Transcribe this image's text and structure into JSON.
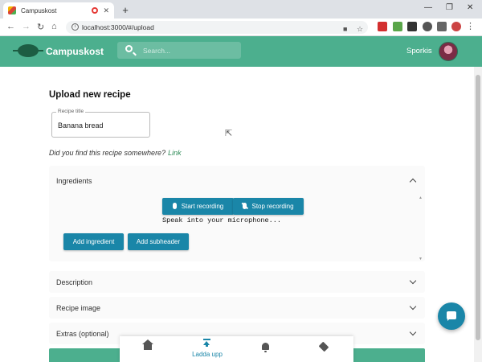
{
  "browser": {
    "tab_title": "Campuskost",
    "url": "localhost:3000/#/upload"
  },
  "header": {
    "brand": "Campuskost",
    "search_placeholder": "Search...",
    "username": "Sporkis"
  },
  "form": {
    "title": "Upload new recipe",
    "recipe_title_label": "Recipe title",
    "recipe_title_value": "Banana bread",
    "found_text": "Did you find this recipe somewhere?",
    "found_link": "Link"
  },
  "ingredients": {
    "heading": "Ingredients",
    "start_recording": "Start recording",
    "stop_recording": "Stop recording",
    "speak_prompt": "Speak into your microphone...",
    "add_ingredient": "Add ingredient",
    "add_subheader": "Add subheader"
  },
  "sections": {
    "description": "Description",
    "recipe_image": "Recipe image",
    "extras": "Extras (optional)"
  },
  "bottom_nav": {
    "upload_label": "Ladda upp"
  },
  "icons": [
    "home-icon",
    "upload-icon",
    "bell-icon",
    "tag-icon",
    "chat-icon",
    "search-icon",
    "mic-icon",
    "mic-off-icon",
    "chevron-up-icon",
    "chevron-down-icon"
  ],
  "colors": {
    "brand_green": "#4caf8e",
    "button_blue": "#1a86a8",
    "link_green": "#2e8b57"
  }
}
